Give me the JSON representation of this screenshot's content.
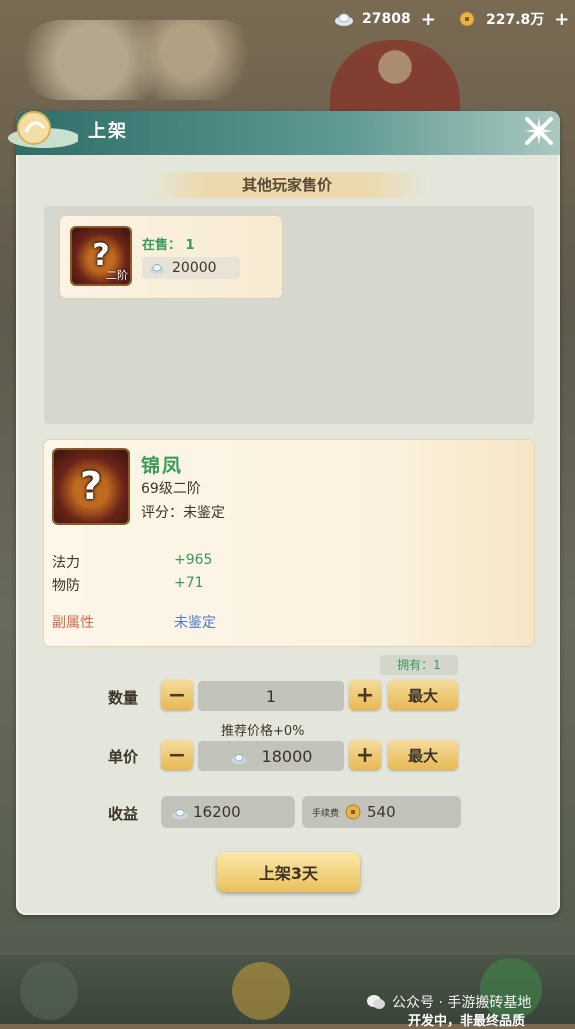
{
  "currency": {
    "silver": "27808",
    "gold": "227.8万",
    "plus": "+"
  },
  "window": {
    "title": "上架"
  },
  "market": {
    "section_title": "其他玩家售价",
    "listing": {
      "on_sale_label": "在售：",
      "on_sale_count": "1",
      "grade": "二阶",
      "price": "20000"
    }
  },
  "item": {
    "name": "锦凤",
    "level": "69级二阶",
    "score_label": "评分：",
    "score_value": "未鉴定",
    "attributes": [
      {
        "label": "法力",
        "value": "+965"
      },
      {
        "label": "物防",
        "value": "+71"
      }
    ],
    "sub_attr_label": "副属性",
    "sub_attr_value": "未鉴定"
  },
  "form": {
    "owned": "拥有：1",
    "quantity_label": "数量",
    "quantity_value": "1",
    "max_label": "最大",
    "recommend": "推荐价格+0%",
    "unit_price_label": "单价",
    "unit_price_value": "18000",
    "income_label": "收益",
    "income_value": "16200",
    "fee_label": "手续费",
    "fee_value": "540",
    "minus": "−",
    "plus": "+"
  },
  "actions": {
    "list_button": "上架3天"
  },
  "footer": {
    "watermark": "公众号 · 手游搬砖基地",
    "dev_note": "开发中，非最终品质"
  },
  "colors": {
    "green_text": "#3a9a5a",
    "title_teal": "#2f6d68",
    "gold_button": "#e7b954",
    "sub_attr_red": "#d06a4a",
    "unidentified_blue": "#4a7ad0"
  },
  "icons": [
    "silver-ingot-icon",
    "gold-coin-icon",
    "close-icon",
    "mystery-helmet-icon",
    "wechat-icon"
  ]
}
